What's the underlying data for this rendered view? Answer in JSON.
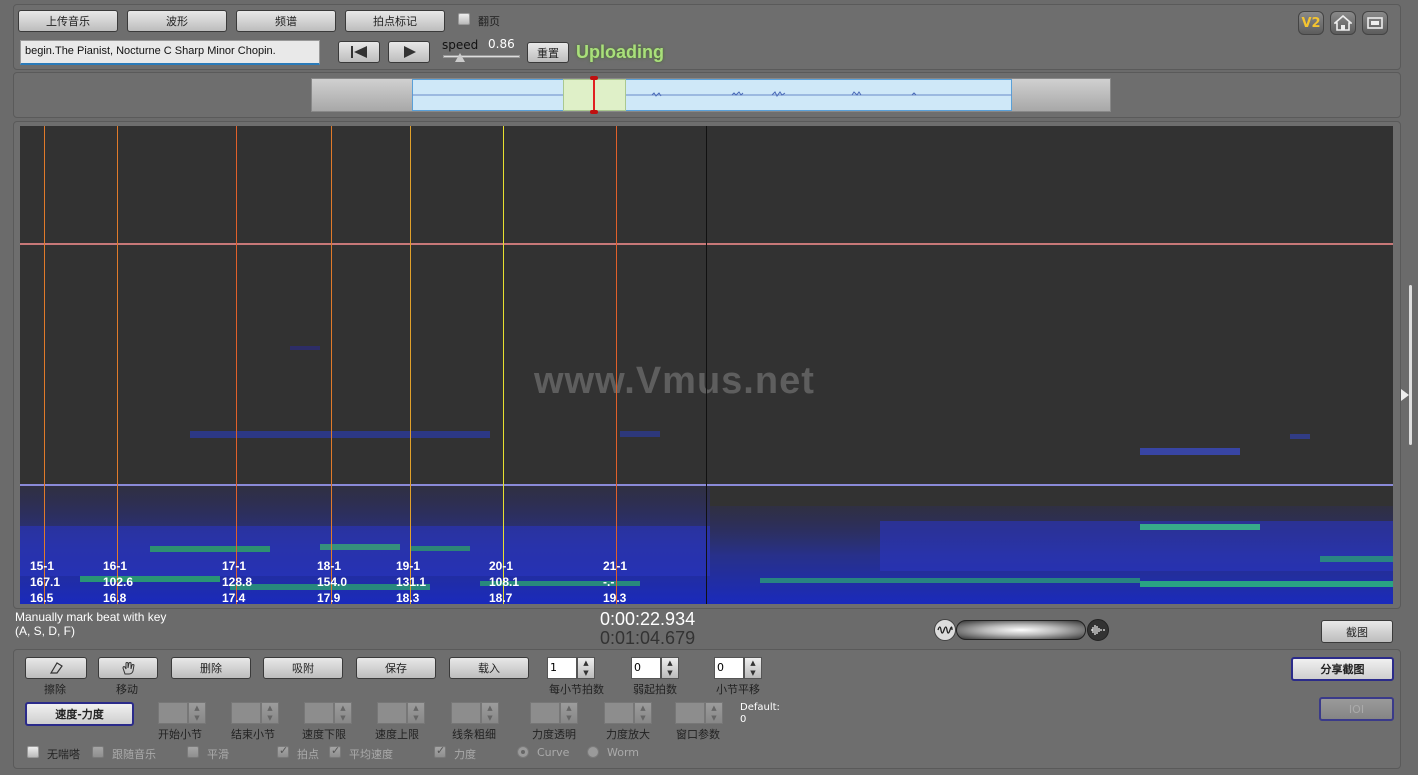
{
  "toolbar": {
    "upload": "上传音乐",
    "waveform": "波形",
    "spectrum": "频谱",
    "beat_mark": "拍点标记",
    "page_turn": "翻页"
  },
  "song": {
    "title": "begin.The Pianist, Nocturne C Sharp Minor Chopin."
  },
  "speed": {
    "label": "speed",
    "value": "0.86",
    "reset": "重置"
  },
  "status": "Uploading",
  "top_icons": {
    "v2": "V2"
  },
  "watermark": "www.Vmus.net",
  "markers": [
    {
      "bar": "15-1",
      "tempo": "167.1",
      "time": "16.5",
      "color": "#e07a2a"
    },
    {
      "bar": "16-1",
      "tempo": "102.6",
      "time": "16.8",
      "color": "#e07a2a"
    },
    {
      "bar": "17-1",
      "tempo": "128.8",
      "time": "17.4",
      "color": "#e0602a"
    },
    {
      "bar": "18-1",
      "tempo": "154.0",
      "time": "17.9",
      "color": "#e07a2a"
    },
    {
      "bar": "19-1",
      "tempo": "131.1",
      "time": "18.3",
      "color": "#e0a02a"
    },
    {
      "bar": "20-1",
      "tempo": "108.1",
      "time": "18.7",
      "color": "#e8e030"
    },
    {
      "bar": "21-1",
      "tempo": "-.-",
      "time": "19.3",
      "color": "#e0602a"
    }
  ],
  "hint": {
    "line1": "Manually mark beat with key",
    "line2": "(A, S, D, F)"
  },
  "time": {
    "current": "0:00:22.934",
    "total": "0:01:04.679"
  },
  "screenshot_btn": "截图",
  "share_btn": "分享截图",
  "ioi_btn": "IOI",
  "edit": {
    "erase": "擦除",
    "move": "移动",
    "delete": "删除",
    "attach": "吸附",
    "save": "保存",
    "load": "载入",
    "beats_per_bar_label": "每小节拍数",
    "beats_per_bar": "1",
    "pickup_label": "弱起拍数",
    "pickup": "0",
    "bar_shift_label": "小节平移",
    "bar_shift": "0"
  },
  "curve": {
    "mode_btn": "速度-力度",
    "start_bar": "开始小节",
    "end_bar": "结束小节",
    "tempo_min": "速度下限",
    "tempo_max": "速度上限",
    "line_width": "线条粗细",
    "dyn_transparency": "力度透明",
    "dyn_zoom": "力度放大",
    "window_param": "窗口参数",
    "default_label": "Default:",
    "default_value": "0"
  },
  "options": {
    "no_breath": "无喘嗒",
    "follow_music": "跟随音乐",
    "smooth": "平滑",
    "beat_point": "拍点",
    "avg_tempo": "平均速度",
    "dynamics": "力度",
    "curve": "Curve",
    "worm": "Worm"
  }
}
